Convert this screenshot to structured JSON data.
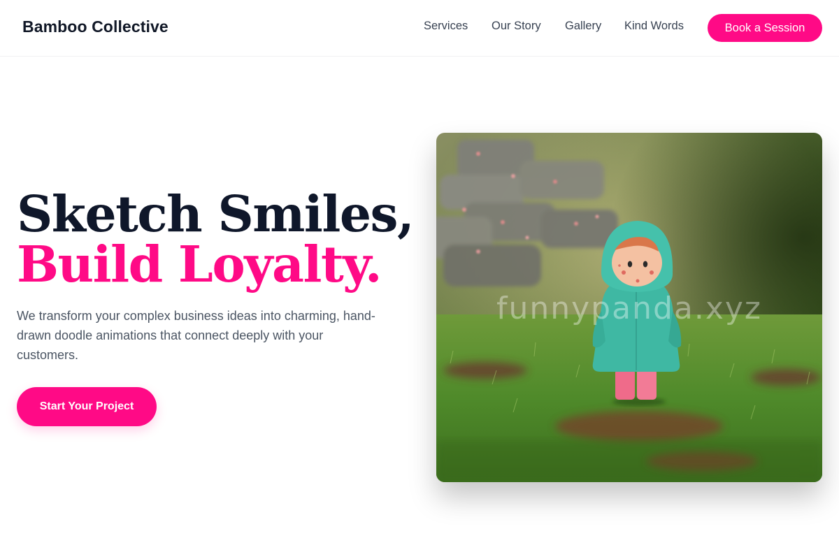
{
  "brand": {
    "name": "Bamboo Collective"
  },
  "nav": {
    "items": [
      {
        "label": "Services"
      },
      {
        "label": "Our Story"
      },
      {
        "label": "Gallery"
      },
      {
        "label": "Kind Words"
      }
    ],
    "cta_label": "Book a Session"
  },
  "hero": {
    "headline_line1": "Sketch Smiles,",
    "headline_line2": "Build Loyalty.",
    "subcopy": "We transform your complex business ideas into charming, hand-drawn doodle animations that connect deeply with your customers.",
    "cta_label": "Start Your Project",
    "image": {
      "subject": "photo of a small figurine in a teal hooded raincoat and pink boots standing in grass",
      "watermark": "funnypanda.xyz"
    }
  },
  "colors": {
    "accent": "#ff0a86",
    "heading": "#0f172a",
    "body_text": "#4b5563",
    "nav_text": "#374151",
    "background": "#ffffff"
  }
}
